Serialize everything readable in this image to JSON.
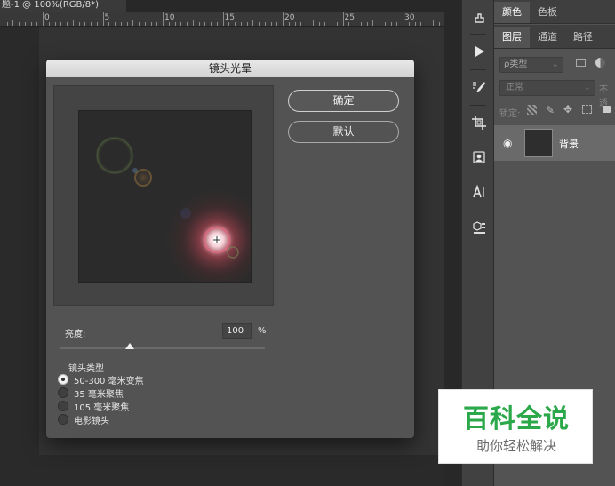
{
  "document": {
    "tab_title": "题-1 @ 100%(RGB/8*)",
    "ruler_numbers": [
      "0",
      "5",
      "10",
      "15",
      "20",
      "25",
      "30"
    ]
  },
  "tools": [
    "history-brush-icon",
    "play-action-icon",
    "brush-settings-icon",
    "crop-icon",
    "stamp-icon",
    "type-icon",
    "3d-material-icon"
  ],
  "panels": {
    "top_tabs": [
      "颜色",
      "色板"
    ],
    "layer_tabs": [
      "图层",
      "通道",
      "路径"
    ],
    "filter_label": "ρ类型",
    "blend_mode": "正常",
    "opacity_label": "不透",
    "lock_label": "锁定:",
    "layer_name": "背景"
  },
  "dialog": {
    "title": "镜头光晕",
    "ok_label": "确定",
    "default_label": "默认",
    "brightness_label": "亮度:",
    "brightness_value": "100",
    "brightness_unit": "%",
    "brightness_level_percent": 100,
    "lens_type_label": "镜头类型",
    "lens_types": [
      {
        "label": "50-300 毫米变焦",
        "selected": true
      },
      {
        "label": "35 毫米聚焦",
        "selected": false
      },
      {
        "label": "105 毫米聚焦",
        "selected": false
      },
      {
        "label": "电影镜头",
        "selected": false
      }
    ]
  },
  "watermark": {
    "title": "百科全说",
    "subtitle": "助你轻松解决",
    "color": "#2aa84a"
  }
}
